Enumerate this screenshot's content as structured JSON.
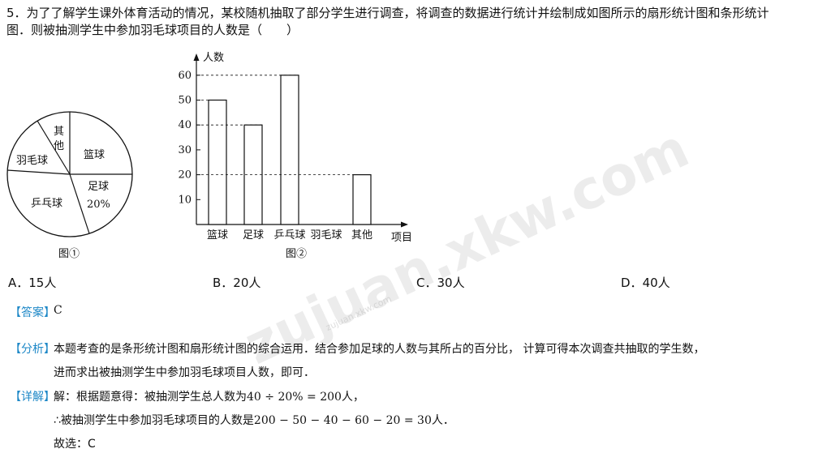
{
  "question": {
    "line1": "5．为了了解学生课外体育活动的情况，某校随机抽取了部分学生进行调查，将调查的数据进行统计并绘制成如图所示的扇形统计图和条形统计",
    "line2": "图．则被抽测学生中参加羽毛球项目的人数是（　　）"
  },
  "pie": {
    "caption": "图①",
    "labels": {
      "other_a": "其",
      "other_b": "他",
      "basketball": "篮球",
      "badminton": "羽毛球",
      "football": "足球",
      "football_pct": "20%",
      "pingpong": "乒乓球"
    }
  },
  "chart_data": {
    "type": "bar",
    "categories": [
      "篮球",
      "足球",
      "乒乓球",
      "羽毛球",
      "其他"
    ],
    "values": [
      50,
      40,
      60,
      null,
      20
    ],
    "ylabel": "人数",
    "xlabel": "项目",
    "yticks": [
      10,
      20,
      30,
      40,
      50,
      60
    ],
    "ylim": [
      0,
      70
    ],
    "caption": "图②",
    "grid": false
  },
  "options": [
    {
      "letter": "A．",
      "value": "15人"
    },
    {
      "letter": "B．",
      "value": "20人"
    },
    {
      "letter": "C．",
      "value": "30人"
    },
    {
      "letter": "D．",
      "value": "40人"
    }
  ],
  "answer": {
    "tag": "【答案】",
    "value": "C"
  },
  "analysis": {
    "tag": "【分析】",
    "line1": "本题考查的是条形统计图和扇形统计图的综合运用．结合参加足球的人数与其所占的百分比， 计算可得本次调查共抽取的学生数，",
    "line2": "进而求出被抽测学生中参加羽毛球项目人数，即可．"
  },
  "detail": {
    "tag": "【详解】",
    "line1_text": "解：根据题意得：被抽测学生总人数为",
    "line1_math": "40 ÷ 20% = 200",
    "line1_end": "人，",
    "line2_text": "∴被抽测学生中参加羽毛球项目的人数是",
    "line2_math": "200 − 50 − 40 − 60 − 20 = 30",
    "line2_end": "人．",
    "line3": "故选：C"
  },
  "watermark": {
    "main": "zujuan.xkw.com",
    "small": "zujuan.xkw.com"
  },
  "colors": {
    "tag": "#1e88c7",
    "text": "#111111"
  }
}
